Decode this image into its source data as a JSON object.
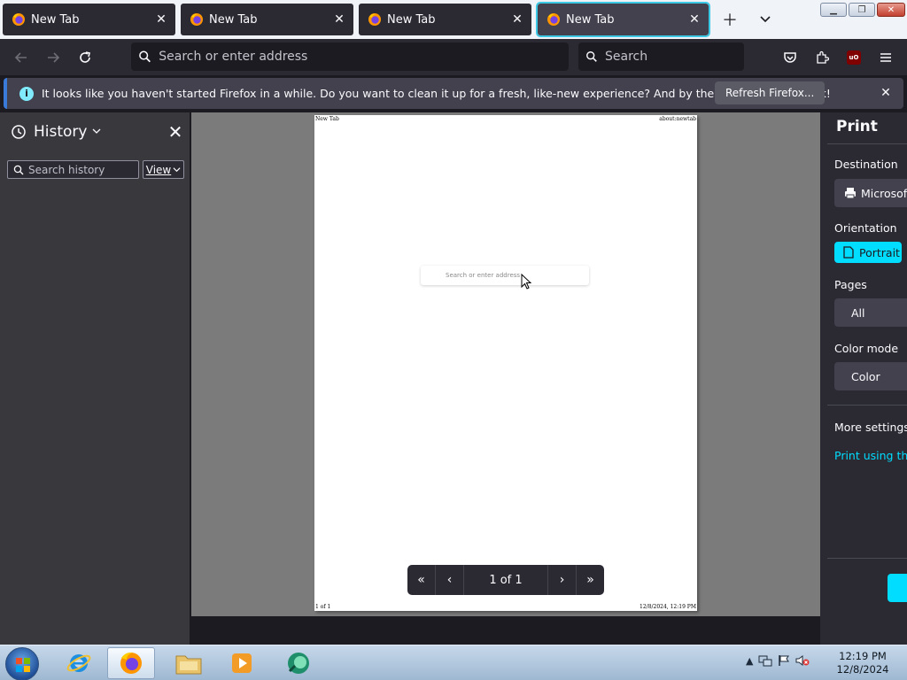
{
  "tabs": [
    {
      "title": "New Tab",
      "active": false
    },
    {
      "title": "New Tab",
      "active": false
    },
    {
      "title": "New Tab",
      "active": false
    },
    {
      "title": "New Tab",
      "active": true
    }
  ],
  "tabstrip": {
    "new_tab_icon": "plus-icon",
    "list_tabs_icon": "chevron-down-icon"
  },
  "navbar": {
    "url_placeholder": "Search or enter address",
    "search_placeholder": "Search"
  },
  "notification": {
    "message": "It looks like you haven't started Firefox in a while. Do you want to clean it up for a fresh, like-new experience? And by the way, welcome back!",
    "button_label": "Refresh Firefox..."
  },
  "sidebar": {
    "title": "History",
    "search_placeholder": "Search history",
    "view_label": "View"
  },
  "preview": {
    "page_header_left": "New Tab",
    "page_header_right": "about:newtab",
    "page_footer_left": "1 of 1",
    "page_footer_right": "12/8/2024, 12:19 PM",
    "mini_search_placeholder": "Search or enter address",
    "pager_label": "1 of 1"
  },
  "print_panel": {
    "title": "Print",
    "destination_label": "Destination",
    "destination_value": "Microsoft",
    "orientation_label": "Orientation",
    "orientation_value": "Portrait",
    "pages_label": "Pages",
    "pages_value": "All",
    "color_mode_label": "Color mode",
    "color_mode_value": "Color",
    "more_settings_label": "More settings",
    "system_dialog_link": "Print using the s"
  },
  "taskbar": {
    "apps": [
      "internet-explorer",
      "firefox",
      "file-explorer",
      "media-player",
      "app"
    ],
    "clock_time": "12:19 PM",
    "clock_date": "12/8/2024"
  },
  "colors": {
    "accent": "#00ddff",
    "active_tab_outline": "#3cc9e6",
    "chrome_dark": "#2b2a33"
  }
}
